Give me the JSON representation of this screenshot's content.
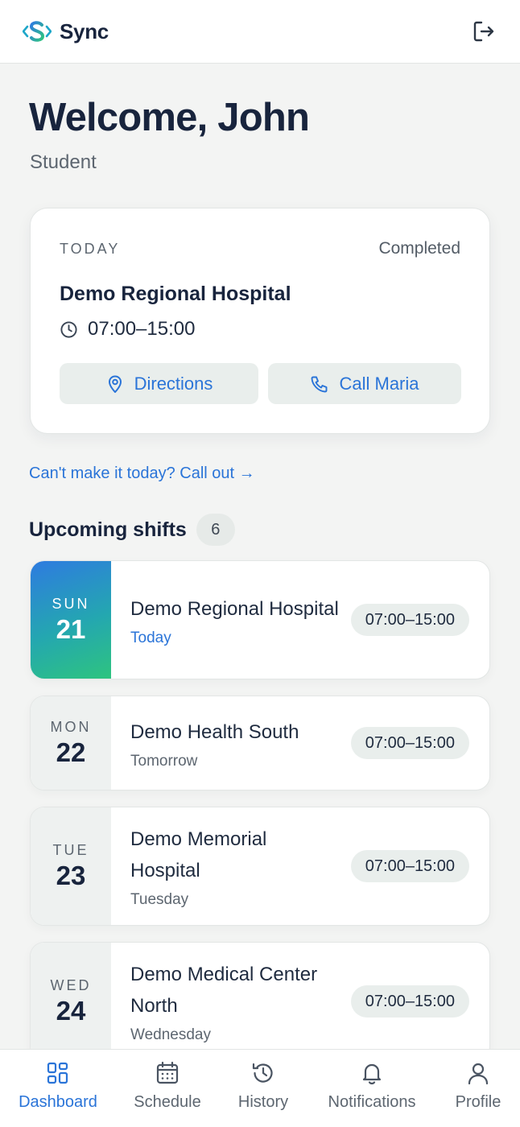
{
  "header": {
    "app_name": "Sync",
    "logo_icon": "sync-logo-icon",
    "logout_icon": "logout-icon"
  },
  "welcome": {
    "title": "Welcome, John",
    "role": "Student"
  },
  "today_card": {
    "label": "TODAY",
    "status": "Completed",
    "hospital": "Demo Regional Hospital",
    "time": "07:00–15:00",
    "directions_label": "Directions",
    "call_label": "Call Maria"
  },
  "callout_link": "Can't make it today? Call out →",
  "upcoming": {
    "title": "Upcoming shifts",
    "count": "6",
    "shifts": [
      {
        "dow": "SUN",
        "day": "21",
        "name": "Demo Regional Hospital",
        "sub": "Today",
        "time": "07:00–15:00"
      },
      {
        "dow": "MON",
        "day": "22",
        "name": "Demo Health South",
        "sub": "Tomorrow",
        "time": "07:00–15:00"
      },
      {
        "dow": "TUE",
        "day": "23",
        "name": "Demo Memorial Hospital",
        "sub": "Tuesday",
        "time": "07:00–15:00"
      },
      {
        "dow": "WED",
        "day": "24",
        "name": "Demo Medical Center North",
        "sub": "Wednesday",
        "time": "07:00–15:00"
      }
    ]
  },
  "nav": {
    "items": [
      {
        "label": "Dashboard",
        "icon": "dashboard-icon"
      },
      {
        "label": "Schedule",
        "icon": "calendar-icon"
      },
      {
        "label": "History",
        "icon": "history-icon"
      },
      {
        "label": "Notifications",
        "icon": "bell-icon"
      },
      {
        "label": "Profile",
        "icon": "user-icon"
      }
    ]
  },
  "colors": {
    "accent": "#2a74d8",
    "text_dark": "#18243d",
    "gradient_start": "#2e7be0",
    "gradient_end": "#2ec47f"
  }
}
